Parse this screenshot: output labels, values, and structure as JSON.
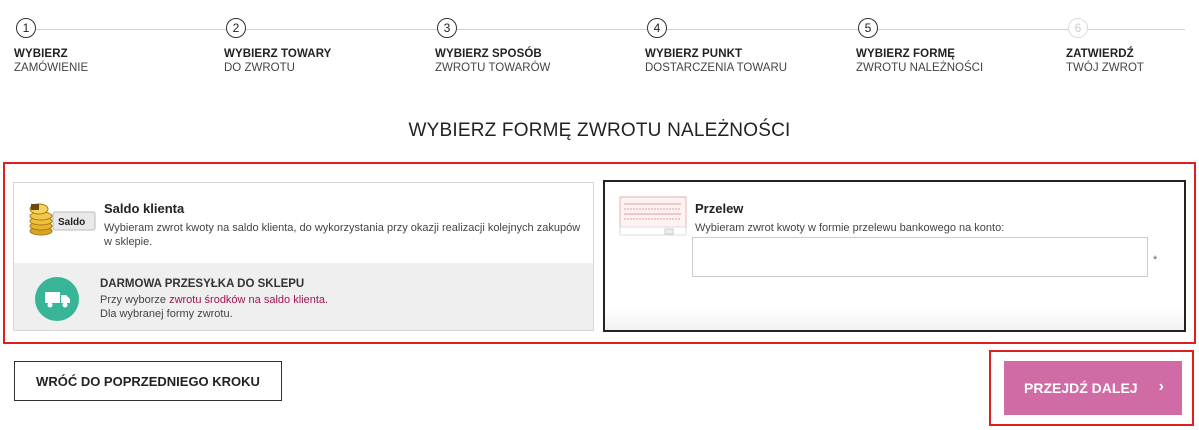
{
  "steps": [
    {
      "num": "1",
      "title": "WYBIERZ",
      "sub": "ZAMÓWIENIE"
    },
    {
      "num": "2",
      "title": "WYBIERZ TOWARY",
      "sub": "DO ZWROTU"
    },
    {
      "num": "3",
      "title": "WYBIERZ SPOSÓB",
      "sub": "ZWROTU TOWARÓW"
    },
    {
      "num": "4",
      "title": "WYBIERZ PUNKT",
      "sub": "DOSTARCZENIA TOWARU"
    },
    {
      "num": "5",
      "title": "WYBIERZ FORMĘ",
      "sub": "ZWROTU NALEŻNOŚCI"
    },
    {
      "num": "6",
      "title": "ZATWIERDŹ",
      "sub": "TWÓJ ZWROT"
    }
  ],
  "heading": "WYBIERZ FORMĘ ZWROTU NALEŻNOŚCI",
  "saldo": {
    "icon_label": "Saldo",
    "title": "Saldo klienta",
    "desc": "Wybieram zwrot kwoty na saldo klienta, do wykorzystania przy okazji realizacji kolejnych zakupów w sklepie.",
    "free_title": "DARMOWA PRZESYŁKA DO SKLEPU",
    "free_line1_pre": "Przy wyborze ",
    "free_line1_hl": "zwrotu środków na saldo klienta.",
    "free_line2": "Dla wybranej formy zwrotu."
  },
  "przelew": {
    "title": "Przelew",
    "desc": "Wybieram zwrot kwoty w formie przelewu bankowego na konto:",
    "account_value": "",
    "required_mark": "*"
  },
  "buttons": {
    "back": "WRÓĆ DO POPRZEDNIEGO KROKU",
    "next": "PRZEJDŹ DALEJ",
    "next_chevron": "›"
  },
  "colors": {
    "accent_pink": "#d16ba5",
    "truck_green": "#38b596",
    "highlight_red": "#e02020",
    "link_magenta": "#a0154f"
  }
}
